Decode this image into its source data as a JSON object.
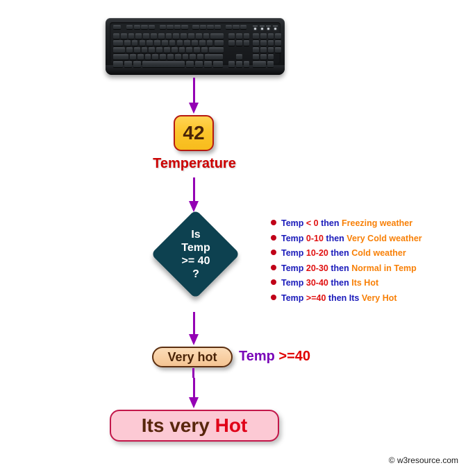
{
  "diagram": {
    "title": "Temperature decision flowchart",
    "input_device": "keyboard-image",
    "value_box": {
      "value": "42"
    },
    "variable_label": "Temperature",
    "decision": {
      "line1": "Is",
      "line2": "Temp",
      "line3": ">= 40",
      "line4": "?"
    },
    "result_pill": "Very hot",
    "condition_label": {
      "prefix": "Temp",
      "operator": ">=40"
    },
    "final_result": {
      "prefix": "Its very",
      "highlight": "Hot"
    }
  },
  "legend": {
    "rows": [
      {
        "prefix": "Temp",
        "range": "< 0",
        "then": "then",
        "result": "Freezing weather"
      },
      {
        "prefix": "Temp",
        "range": "0-10",
        "then": "then",
        "result": "Very Cold weather"
      },
      {
        "prefix": "Temp",
        "range": "10-20",
        "then": "then",
        "result": "Cold weather"
      },
      {
        "prefix": "Temp",
        "range": "20-30",
        "then": "then",
        "result": "Normal in Temp"
      },
      {
        "prefix": "Temp",
        "range": "30-40",
        "then": "then",
        "result": "Its Hot"
      },
      {
        "prefix": "Temp",
        "range": ">=40",
        "then": "then Its",
        "result": "Very Hot"
      }
    ]
  },
  "footer": {
    "copyright": "© w3resource.com"
  },
  "colors": {
    "arrow": "#9400b4",
    "value_box_fill": "#fcc52c",
    "value_box_border": "#b61a10",
    "variable_label": "#cc0000",
    "diamond_fill": "#0d4150",
    "legend_bullet": "#c00018",
    "legend_prefix": "#1a1aba",
    "legend_range": "#e01010",
    "legend_result": "#f88007",
    "pill_fill": "#f8cfa3",
    "pill_border": "#5c2f10",
    "condition_purple": "#7a06b8",
    "condition_red": "#e00000",
    "final_fill": "#fcc9d4",
    "final_border": "#c3174a",
    "final_text": "#58260c",
    "final_highlight": "#e00018"
  }
}
